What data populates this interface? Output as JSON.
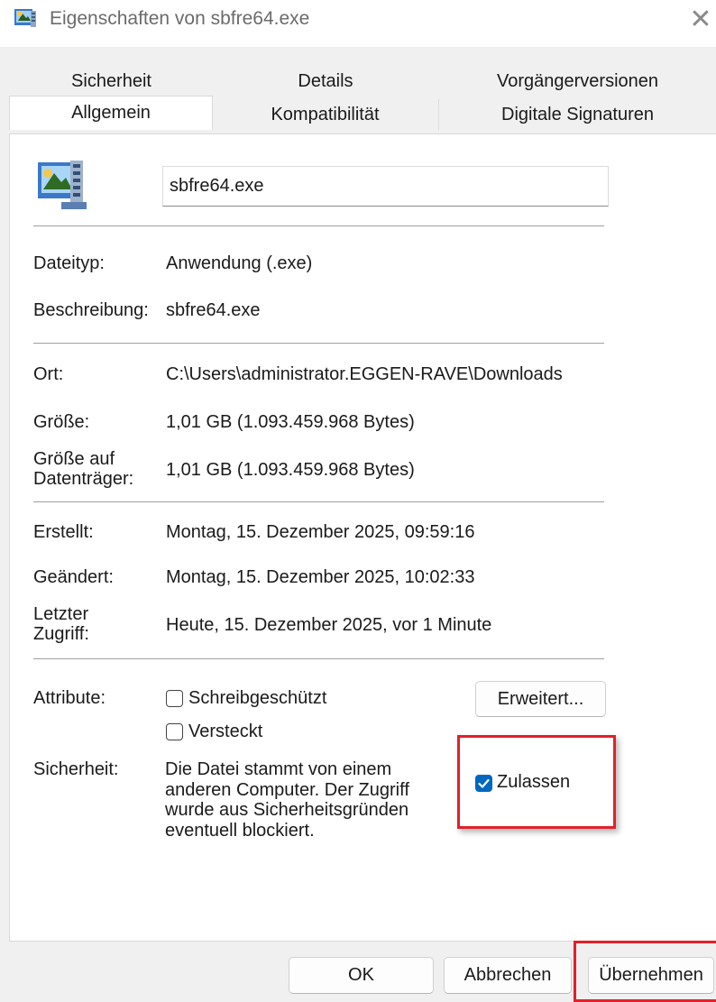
{
  "window": {
    "title": "Eigenschaften von sbfre64.exe",
    "close_glyph": "✕",
    "title_icon": "exe-file-icon"
  },
  "tabs": {
    "row1": [
      {
        "label": "Sicherheit"
      },
      {
        "label": "Details"
      },
      {
        "label": "Vorgängerversionen"
      }
    ],
    "row2": [
      {
        "label": "Allgemein",
        "active": true
      },
      {
        "label": "Kompatibilität"
      },
      {
        "label": "Digitale Signaturen"
      }
    ]
  },
  "general": {
    "file_icon": "exe-file-icon",
    "filename": "sbfre64.exe",
    "type_label": "Dateityp:",
    "type_value": "Anwendung (.exe)",
    "description_label": "Beschreibung:",
    "description_value": "sbfre64.exe",
    "location_label": "Ort:",
    "location_value": "C:\\Users\\administrator.EGGEN-RAVE\\Downloads",
    "size_label": "Größe:",
    "size_value": "1,01 GB (1.093.459.968 Bytes)",
    "size_on_disk_label_line1": "Größe auf",
    "size_on_disk_label_line2": "Datenträger:",
    "size_on_disk_value": "1,01 GB (1.093.459.968 Bytes)",
    "created_label": "Erstellt:",
    "created_value": "Montag, 15. Dezember 2025, 09:59:16",
    "modified_label": "Geändert:",
    "modified_value": "Montag, 15. Dezember 2025, 10:02:33",
    "accessed_label_line1": "Letzter",
    "accessed_label_line2": "Zugriff:",
    "accessed_value": "Heute, 15. Dezember 2025, vor 1 Minute",
    "attributes_label": "Attribute:",
    "readonly_label": "Schreibgeschützt",
    "readonly_checked": false,
    "hidden_label": "Versteckt",
    "hidden_checked": false,
    "advanced_button": "Erweitert...",
    "security_label": "Sicherheit:",
    "security_text": "Die Datei stammt von einem anderen Computer. Der Zugriff wurde aus Sicherheitsgründen eventuell blockiert.",
    "unblock_label": "Zulassen",
    "unblock_checked": true
  },
  "footer": {
    "ok": "OK",
    "cancel": "Abbrechen",
    "apply": "Übernehmen"
  },
  "colors": {
    "highlight": "#e3202a",
    "checkbox_checked": "#0067c0",
    "dialog_background": "#f0f0f0",
    "panel_background": "#ffffff"
  }
}
